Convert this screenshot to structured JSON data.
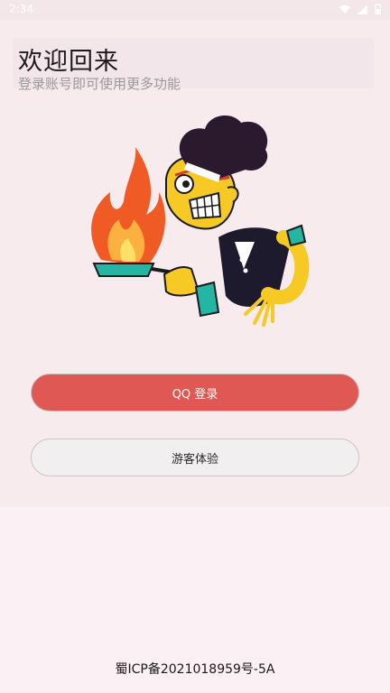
{
  "status_bar": {
    "time": "2:34",
    "icons": [
      "wifi-icon",
      "signal-icon",
      "battery-icon"
    ]
  },
  "welcome": {
    "title": "欢迎回来",
    "subtitle": "登录账号即可使用更多功能"
  },
  "illustration": {
    "description_icon": "chef-with-flaming-pan-illustration"
  },
  "buttons": {
    "qq_login": "QQ 登录",
    "guest": "游客体验"
  },
  "footer": {
    "icp": "蜀ICP备2021018959号-5A"
  },
  "colors": {
    "primary": "#df5853",
    "background": "#fbf0f3",
    "card": "#f7ebee"
  }
}
